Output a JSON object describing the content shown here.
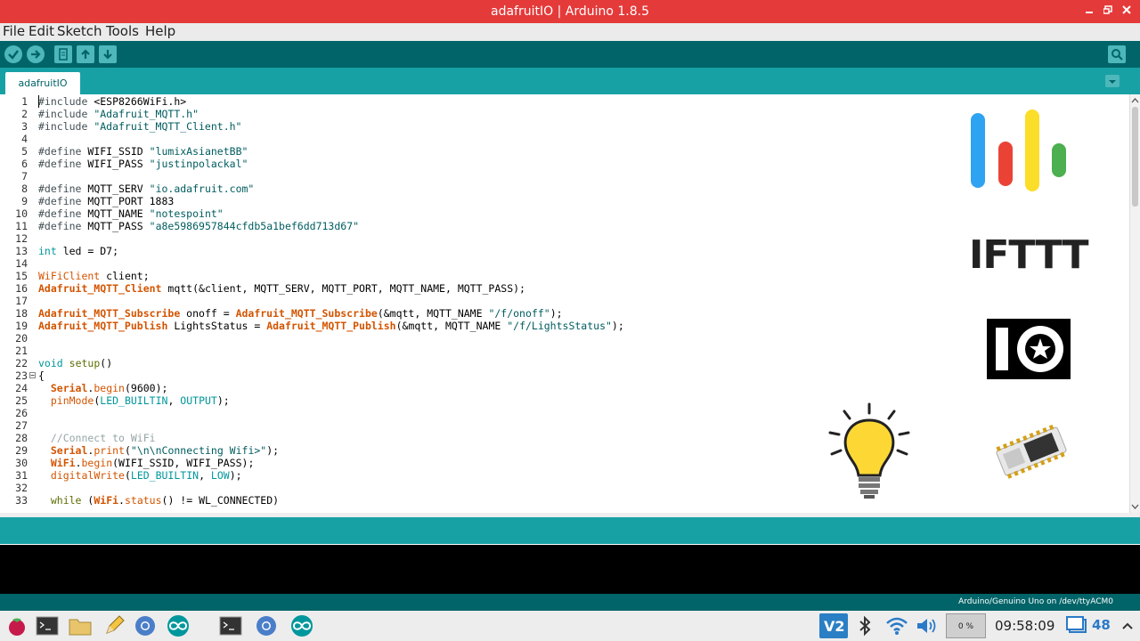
{
  "window": {
    "title": "adafruitIO | Arduino 1.8.5"
  },
  "menu": {
    "file": "File",
    "edit": "Edit",
    "sketch": "Sketch",
    "tools": "Tools",
    "help": "Help"
  },
  "tab": {
    "label": "adafruitIO"
  },
  "code_lines": [
    "1",
    "2",
    "3",
    "4",
    "5",
    "6",
    "7",
    "8",
    "9",
    "10",
    "11",
    "12",
    "13",
    "14",
    "15",
    "16",
    "17",
    "18",
    "19",
    "20",
    "21",
    "22",
    "23",
    "24",
    "25",
    "26",
    "27",
    "28",
    "29",
    "30",
    "31",
    "32",
    "33"
  ],
  "code": {
    "l1_a": "#include ",
    "l1_b": "<ESP8266WiFi.h>",
    "l2_a": "#include ",
    "l2_b": "\"Adafruit_MQTT.h\"",
    "l3_a": "#include ",
    "l3_b": "\"Adafruit_MQTT_Client.h\"",
    "l5_a": "#define ",
    "l5_b": "WIFI_SSID ",
    "l5_c": "\"lumixAsianetBB\"",
    "l6_a": "#define ",
    "l6_b": "WIFI_PASS ",
    "l6_c": "\"justinpolackal\"",
    "l8_a": "#define ",
    "l8_b": "MQTT_SERV ",
    "l8_c": "\"io.adafruit.com\"",
    "l9_a": "#define ",
    "l9_b": "MQTT_PORT 1883",
    "l10_a": "#define ",
    "l10_b": "MQTT_NAME ",
    "l10_c": "\"notespoint\"",
    "l11_a": "#define ",
    "l11_b": "MQTT_PASS ",
    "l11_c": "\"a8e5986957844cfdb5a1bef6dd713d67\"",
    "l13_a": "int",
    "l13_b": " led = D7;",
    "l15_a": "WiFiClient",
    "l15_b": " client;",
    "l16_a": "Adafruit_MQTT_Client",
    "l16_b": " mqtt(&client, MQTT_SERV, MQTT_PORT, MQTT_NAME, MQTT_PASS);",
    "l18_a": "Adafruit_MQTT_Subscribe",
    "l18_b": " onoff = ",
    "l18_c": "Adafruit_MQTT_Subscribe",
    "l18_d": "(&mqtt, MQTT_NAME ",
    "l18_e": "\"/f/onoff\"",
    "l18_f": ");",
    "l19_a": "Adafruit_MQTT_Publish",
    "l19_b": " LightsStatus = ",
    "l19_c": "Adafruit_MQTT_Publish",
    "l19_d": "(&mqtt, MQTT_NAME ",
    "l19_e": "\"/f/LightsStatus\"",
    "l19_f": ");",
    "l22_a": "void",
    "l22_b": " ",
    "l22_c": "setup",
    "l22_d": "()",
    "l23": "{",
    "l24_a": "  ",
    "l24_b": "Serial",
    "l24_c": ".",
    "l24_d": "begin",
    "l24_e": "(9600);",
    "l25_a": "  ",
    "l25_b": "pinMode",
    "l25_c": "(",
    "l25_d": "LED_BUILTIN",
    "l25_e": ", ",
    "l25_f": "OUTPUT",
    "l25_g": ");",
    "l28": "  //Connect to WiFi",
    "l29_a": "  ",
    "l29_b": "Serial",
    "l29_c": ".",
    "l29_d": "print",
    "l29_e": "(",
    "l29_f": "\"\\n\\nConnecting Wifi>\"",
    "l29_g": ");",
    "l30_a": "  ",
    "l30_b": "WiFi",
    "l30_c": ".",
    "l30_d": "begin",
    "l30_e": "(WIFI_SSID, WIFI_PASS);",
    "l31_a": "  ",
    "l31_b": "digitalWrite",
    "l31_c": "(",
    "l31_d": "LED_BUILTIN",
    "l31_e": ", ",
    "l31_f": "LOW",
    "l31_g": ");",
    "l33_a": "  ",
    "l33_b": "while",
    "l33_c": " (",
    "l33_d": "WiFi",
    "l33_e": ".",
    "l33_f": "status",
    "l33_g": "() != WL_CONNECTED)"
  },
  "overlay": {
    "ifttt_logo": "IFTTT"
  },
  "status_bar": {
    "board": "Arduino/Genuino Uno on /dev/ttyACM0"
  },
  "taskbar": {
    "clock": "09:58:09",
    "cpu": "0 %",
    "notifications": "48"
  },
  "colors": {
    "title_bar": "#e53a3a",
    "toolbar": "#006468",
    "tab_strip": "#17a1a5"
  }
}
